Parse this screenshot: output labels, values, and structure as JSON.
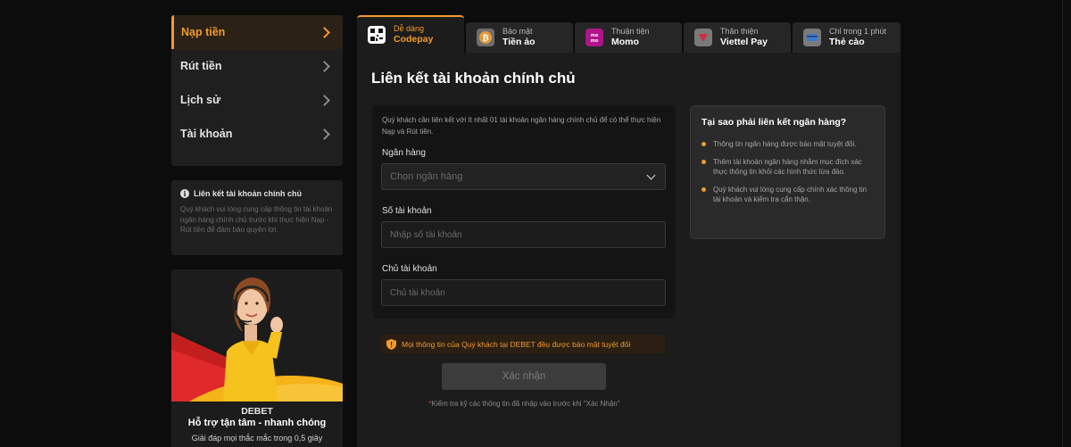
{
  "sidebar": {
    "items": [
      {
        "label": "Nạp tiền"
      },
      {
        "label": "Rút tiền"
      },
      {
        "label": "Lịch sử"
      },
      {
        "label": "Tài khoản"
      }
    ]
  },
  "side_info": {
    "title": "Liên kết tài khoản chính chủ",
    "text": "Quý khách vui lòng cung cấp thông tin tài khoản ngân hàng chính chủ trước khi thực hiện Nạp - Rút tiền để đảm bảo quyền lợi."
  },
  "support": {
    "brand": "DEBET",
    "tagline": "Hỗ trợ tận tâm - nhanh chóng",
    "sub": "Giải đáp mọi thắc mắc trong 0,5 giây"
  },
  "tabs": [
    {
      "top": "Dễ dàng",
      "bottom": "Codepay",
      "icon": "qr-code-icon"
    },
    {
      "top": "Bảo mật",
      "bottom": "Tiền ảo",
      "icon": "bitcoin-icon"
    },
    {
      "top": "Thuận tiện",
      "bottom": "Momo",
      "icon": "momo-icon"
    },
    {
      "top": "Thân thiện",
      "bottom": "Viettel Pay",
      "icon": "viettel-pay-icon"
    },
    {
      "top": "Chỉ trong 1 phút",
      "bottom": "Thẻ cào",
      "icon": "card-icon"
    }
  ],
  "main": {
    "title": "Liên kết tài khoản chính chủ",
    "form": {
      "note": "Quý khách cần liên kết với ít nhất 01 tài khoản ngân hàng chính chủ để có thể thực hiện Nạp và Rút tiền.",
      "bank_label": "Ngân hàng",
      "bank_placeholder": "Chọn ngân hàng",
      "account_number_label": "Số tài khoản",
      "account_number_placeholder": "Nhập số tài khoản",
      "account_holder_label": "Chủ tài khoản",
      "account_holder_placeholder": "Chủ tài khoản"
    },
    "secure_note": "Mọi thông tin của Quý khách tại DEBET đều được bảo mật tuyệt đối",
    "confirm_button": "Xác nhận",
    "footer_star": "*",
    "footer_note": "Kiểm tra kỹ các thông tin đã nhập vào trước khi \"Xác Nhận\"",
    "why": {
      "title": "Tại sao phải liên kết ngân hàng?",
      "items": [
        "Thông tin ngân hàng được bảo mật tuyệt đối.",
        "Thêm tài khoản ngân hàng nhằm mục đích xác thực thông tin khỏi các hình thức lừa đảo.",
        "Quý khách vui lòng cung cấp chính xác thông tin tài khoản và kiểm tra cẩn thận."
      ]
    }
  },
  "colors": {
    "accent": "#f39a2e",
    "background": "#0c0c0c",
    "panel": "#1c1c1c"
  }
}
